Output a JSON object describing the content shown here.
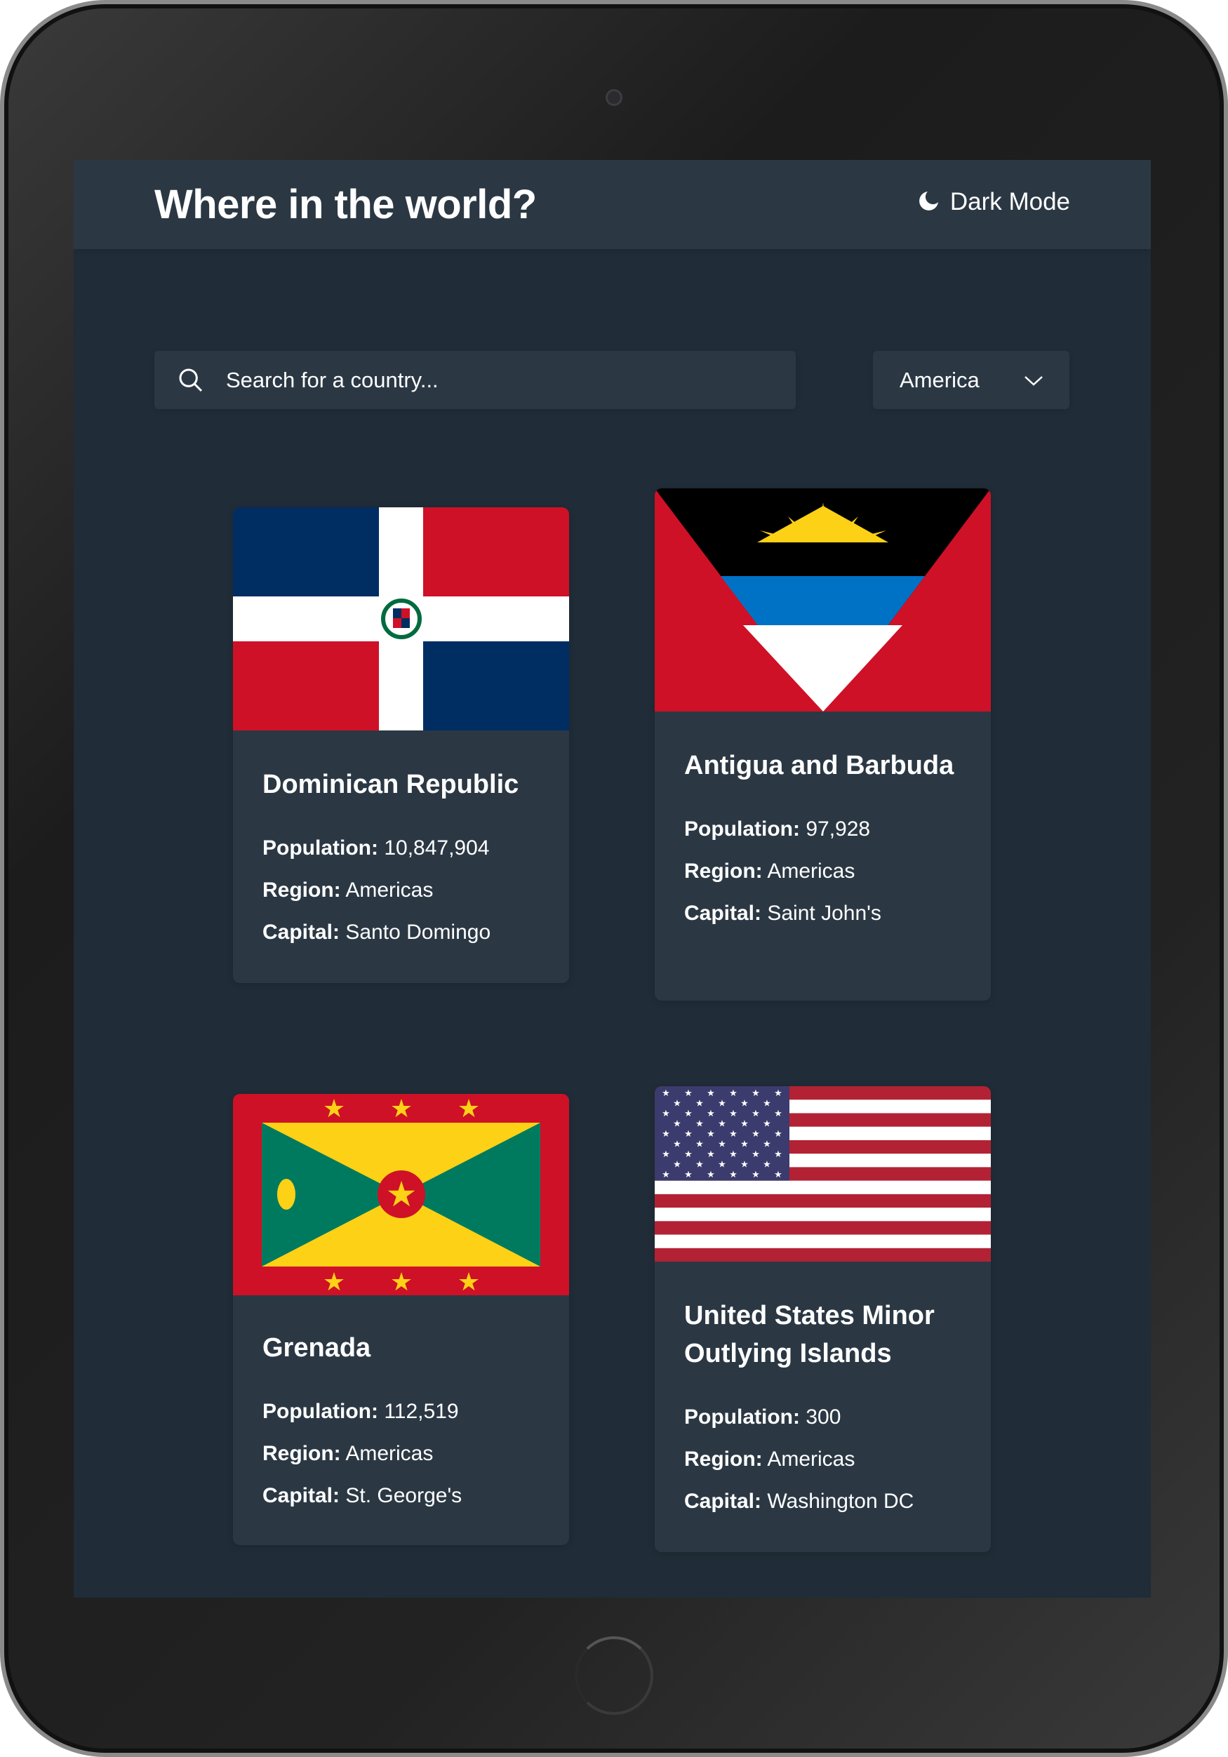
{
  "header": {
    "title": "Where in the world?",
    "dark_mode_label": "Dark Mode"
  },
  "search": {
    "placeholder": "Search for a country..."
  },
  "filter": {
    "selected": "America"
  },
  "labels": {
    "population": "Population:",
    "region": "Region:",
    "capital": "Capital:"
  },
  "countries": [
    {
      "name": "Dominican Republic",
      "population": "10,847,904",
      "region": "Americas",
      "capital": "Santo Domingo",
      "flag": "dominican-republic"
    },
    {
      "name": "Antigua and Barbuda",
      "population": "97,928",
      "region": "Americas",
      "capital": "Saint John's",
      "flag": "antigua-and-barbuda"
    },
    {
      "name": "Grenada",
      "population": "112,519",
      "region": "Americas",
      "capital": "St. George's",
      "flag": "grenada"
    },
    {
      "name": "United States Minor Outlying Islands",
      "population": "300",
      "region": "Americas",
      "capital": "Washington DC",
      "flag": "united-states"
    }
  ],
  "colors": {
    "background": "#202c37",
    "element": "#2b3844",
    "text": "#ffffff"
  }
}
